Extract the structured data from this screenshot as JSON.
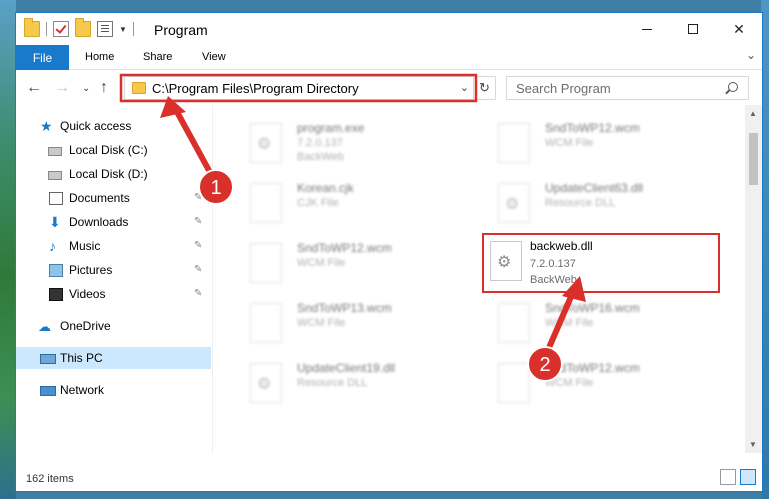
{
  "window": {
    "title": "Program"
  },
  "ribbon": {
    "file_tab": "File",
    "tabs": [
      "Home",
      "Share",
      "View"
    ]
  },
  "nav": {
    "address": "C:\\Program Files\\Program Directory",
    "search_placeholder": "Search Program"
  },
  "sidebar": {
    "items": [
      {
        "label": "Quick access",
        "icon": "star-icon",
        "pinned": false
      },
      {
        "label": "Local Disk (C:)",
        "icon": "disk-icon",
        "pinned": false
      },
      {
        "label": "Local Disk (D:)",
        "icon": "disk-icon",
        "pinned": false
      },
      {
        "label": "Documents",
        "icon": "document-icon",
        "pinned": true
      },
      {
        "label": "Downloads",
        "icon": "download-icon",
        "pinned": true
      },
      {
        "label": "Music",
        "icon": "music-icon",
        "pinned": true
      },
      {
        "label": "Pictures",
        "icon": "picture-icon",
        "pinned": true
      },
      {
        "label": "Videos",
        "icon": "video-icon",
        "pinned": true
      },
      {
        "label": "OneDrive",
        "icon": "cloud-icon",
        "pinned": false
      },
      {
        "label": "This PC",
        "icon": "computer-icon",
        "pinned": false,
        "selected": true
      },
      {
        "label": "Network",
        "icon": "network-icon",
        "pinned": false
      }
    ]
  },
  "files": [
    {
      "name": "program.exe",
      "version": "7.2.0.137",
      "type": "BackWeb",
      "blurred": true
    },
    {
      "name": "SndToWP12.wcm",
      "type": "WCM File",
      "blurred": true
    },
    {
      "name": "Korean.cjk",
      "type": "CJK File",
      "blurred": true
    },
    {
      "name": "UpdateClient63.dll",
      "type": "Resource DLL",
      "blurred": true
    },
    {
      "name": "SndToWP12.wcm",
      "type": "WCM File",
      "blurred": true
    },
    {
      "name": "backweb.dll",
      "version": "7.2.0.137",
      "type": "BackWeb",
      "blurred": false,
      "highlighted": true
    },
    {
      "name": "SndToWP13.wcm",
      "type": "WCM File",
      "blurred": true
    },
    {
      "name": "SndToWP16.wcm",
      "type": "WCM File",
      "blurred": true
    },
    {
      "name": "UpdateClient19.dll",
      "type": "Resource DLL",
      "blurred": true
    },
    {
      "name": "SndToWP12.wcm",
      "type": "WCM File",
      "blurred": true
    }
  ],
  "status": {
    "item_count": "162 items"
  },
  "annotations": {
    "badge_1": "1",
    "badge_2": "2"
  },
  "colors": {
    "accent": "#1979ca",
    "annotation": "#d9302b",
    "selection": "#cce8ff"
  }
}
